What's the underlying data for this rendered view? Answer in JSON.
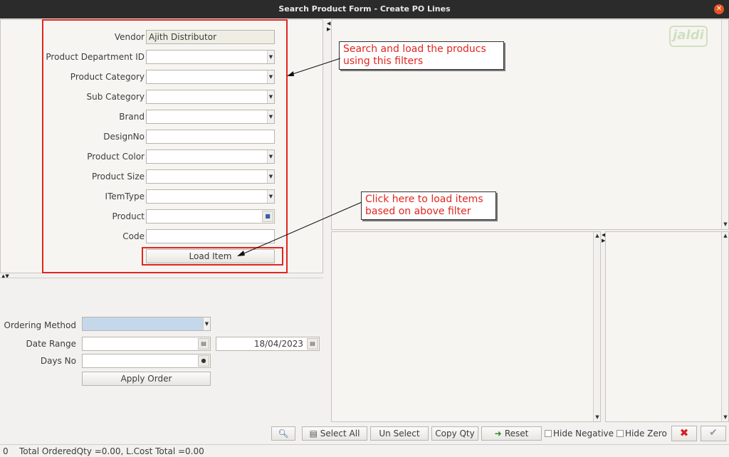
{
  "window": {
    "title": "Search Product Form - Create PO Lines"
  },
  "filters": {
    "vendor_label": "Vendor",
    "vendor_value": "Ajith Distributor",
    "department_label": "Product Department ID",
    "category_label": "Product Category",
    "subcategory_label": "Sub Category",
    "brand_label": "Brand",
    "designno_label": "DesignNo",
    "color_label": "Product Color",
    "size_label": "Product Size",
    "itemtype_label": "ITemType",
    "product_label": "Product",
    "code_label": "Code",
    "load_button": "Load Item"
  },
  "ordering": {
    "method_label": "Ordering Method",
    "date_range_label": "Date Range",
    "date_to_value": "18/04/2023",
    "days_no_label": "Days No",
    "apply_button": "Apply Order"
  },
  "callouts": {
    "filter_note": "Search and load the producs using this filters",
    "load_note": "Click here to load items based on above filter"
  },
  "toolbar": {
    "select_all": "Select All",
    "unselect": "Un Select",
    "copy_qty": "Copy Qty",
    "reset": "Reset",
    "hide_negative": "Hide Negative",
    "hide_zero": "Hide Zero"
  },
  "status": {
    "count": "0",
    "totals": "Total OrderedQty =0.00, L.Cost Total =0.00"
  },
  "logo": {
    "text": "jaldi"
  },
  "colors": {
    "accent": "#e0261f",
    "titlebar": "#2b2b2b",
    "close": "#e95420"
  }
}
